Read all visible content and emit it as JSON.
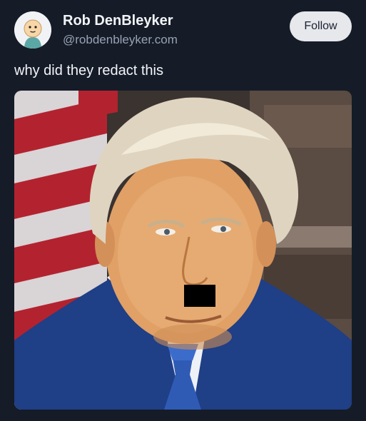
{
  "author": {
    "name": "Rob DenBleyker",
    "handle": "@robdenbleyker.com",
    "avatar_icon": "cyanide-and-happiness-avatar"
  },
  "actions": {
    "follow_label": "Follow"
  },
  "post": {
    "text": "why did they redact this",
    "image": {
      "description_icon": "portrait-photo",
      "redaction_color": "#000000"
    }
  },
  "colors": {
    "background": "#151c28",
    "text_primary": "#f2f4f7",
    "text_secondary": "#98a2b3",
    "follow_button_bg": "#e6e8ec"
  }
}
